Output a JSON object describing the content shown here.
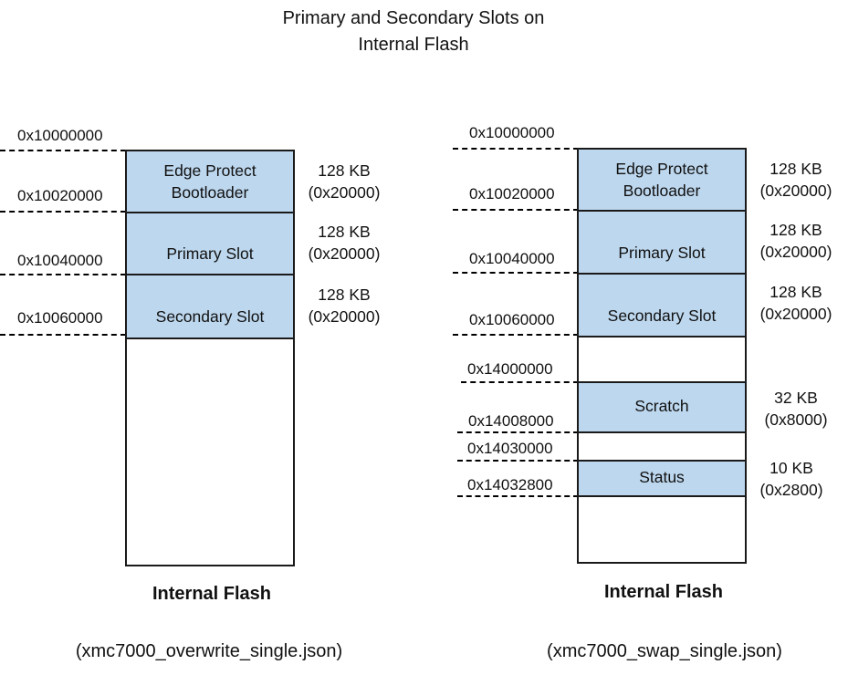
{
  "title_line1": "Primary and Secondary Slots on",
  "title_line2": "Internal Flash",
  "colors": {
    "slot_fill": "#bdd7ee",
    "border": "#1a1a1a"
  },
  "left": {
    "caption": "Internal Flash",
    "file": "(xmc7000_overwrite_single.json)",
    "addresses": [
      "0x10000000",
      "0x10020000",
      "0x10040000",
      "0x10060000"
    ],
    "regions": [
      {
        "label_line1": "Edge Protect",
        "label_line2": "Bootloader",
        "size": "128 KB",
        "size_hex": "(0x20000)"
      },
      {
        "label_line1": "Primary Slot",
        "label_line2": "",
        "size": "128 KB",
        "size_hex": "(0x20000)"
      },
      {
        "label_line1": "Secondary Slot",
        "label_line2": "",
        "size": "128 KB",
        "size_hex": "(0x20000)"
      }
    ]
  },
  "right": {
    "caption": "Internal Flash",
    "file": "(xmc7000_swap_single.json)",
    "addresses": [
      "0x10000000",
      "0x10020000",
      "0x10040000",
      "0x10060000",
      "0x14000000",
      "0x14008000",
      "0x14030000",
      "0x14032800"
    ],
    "regions": [
      {
        "label_line1": "Edge Protect",
        "label_line2": "Bootloader",
        "size": "128 KB",
        "size_hex": "(0x20000)"
      },
      {
        "label_line1": "Primary Slot",
        "label_line2": "",
        "size": "128 KB",
        "size_hex": "(0x20000)"
      },
      {
        "label_line1": "Secondary Slot",
        "label_line2": "",
        "size": "128 KB",
        "size_hex": "(0x20000)"
      },
      {
        "label_line1": "Scratch",
        "label_line2": "",
        "size": "32 KB",
        "size_hex": "(0x8000)"
      },
      {
        "label_line1": "Status",
        "label_line2": "",
        "size": "10 KB",
        "size_hex": "(0x2800)"
      }
    ]
  }
}
